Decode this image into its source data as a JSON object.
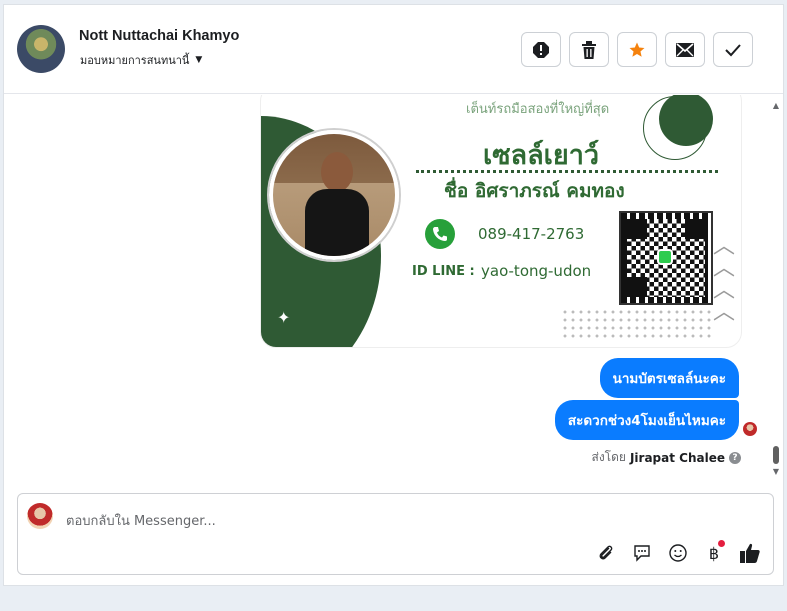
{
  "header": {
    "contact_name": "Nott Nuttachai Khamyo",
    "assign_label": "มอบหมายการสนทนานี้",
    "actions": [
      {
        "name": "report-spam-button",
        "icon": "alert-icon"
      },
      {
        "name": "delete-button",
        "icon": "trash-icon"
      },
      {
        "name": "star-button",
        "icon": "star-icon",
        "color": "#f5820d"
      },
      {
        "name": "mark-unread-button",
        "icon": "envelope-icon"
      },
      {
        "name": "mark-done-button",
        "icon": "check-icon"
      }
    ]
  },
  "card": {
    "slogan": "เต็นท์รถมือสองที่ใหญ่ที่สุด",
    "shop_name": "เซลล์เยาว์",
    "person": "ชื่อ อิศราภรณ์ คมทอง",
    "phone": "089-417-2763",
    "id_label": "ID LINE :",
    "id_value": "yao-tong-udon"
  },
  "messages": [
    {
      "text": "นามบัตรเซลล์นะคะ"
    },
    {
      "text": "สะดวกช่วง4โมงเย็นไหมคะ"
    }
  ],
  "sent_by": {
    "prefix": "ส่งโดย",
    "name": "Jirapat Chalee"
  },
  "composer": {
    "placeholder": "ตอบกลับใน Messenger..."
  },
  "colors": {
    "bubble": "#0a7cff",
    "card_green": "#2f5a34",
    "star": "#f5820d"
  }
}
